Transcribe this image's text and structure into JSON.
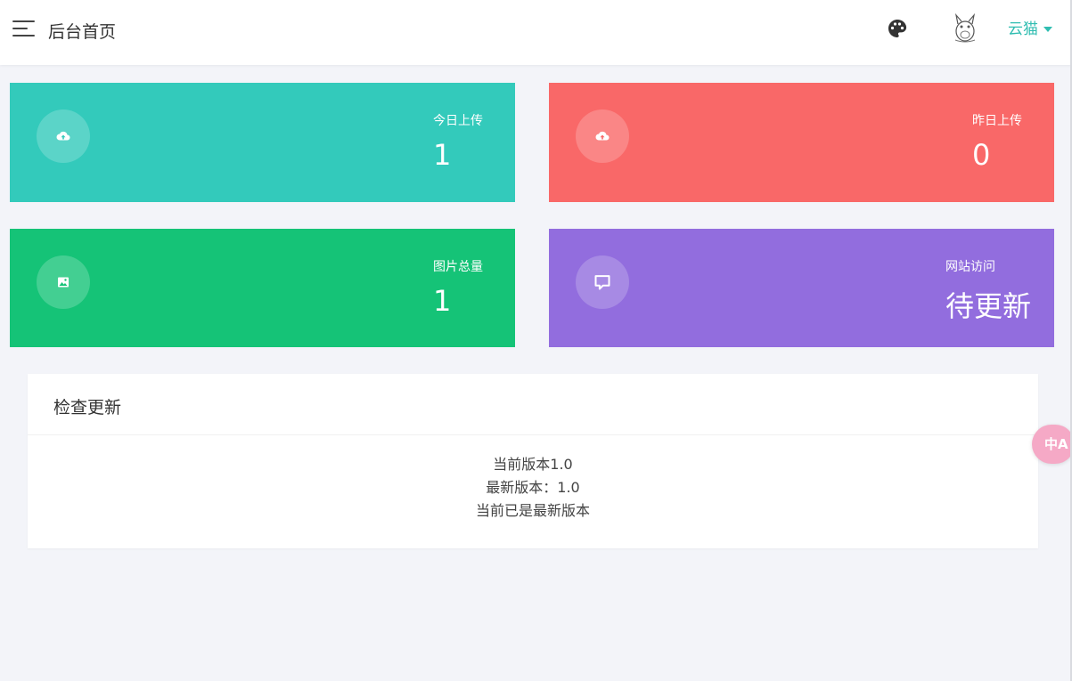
{
  "header": {
    "title": "后台首页",
    "user_name": "云猫",
    "theme_icon": "palette-icon",
    "menu_icon": "hamburger-menu-icon"
  },
  "stats": [
    {
      "label": "今日上传",
      "value": "1",
      "icon": "cloud-upload-icon",
      "color": "#33cabb"
    },
    {
      "label": "昨日上传",
      "value": "0",
      "icon": "cloud-upload-icon",
      "color": "#f96868"
    },
    {
      "label": "图片总量",
      "value": "1",
      "icon": "image-icon",
      "color": "#15c377"
    },
    {
      "label": "网站访问",
      "value": "待更新",
      "icon": "comment-icon",
      "color": "#926dde"
    }
  ],
  "update_panel": {
    "title": "检查更新",
    "current_version": "当前版本1.0",
    "latest_version": "最新版本：1.0",
    "status": "当前已是最新版本"
  },
  "translate_button": {
    "label": "中A",
    "icon": "translate-icon"
  },
  "colors": {
    "accent": "#30bdb1",
    "background": "#f3f4f9"
  }
}
